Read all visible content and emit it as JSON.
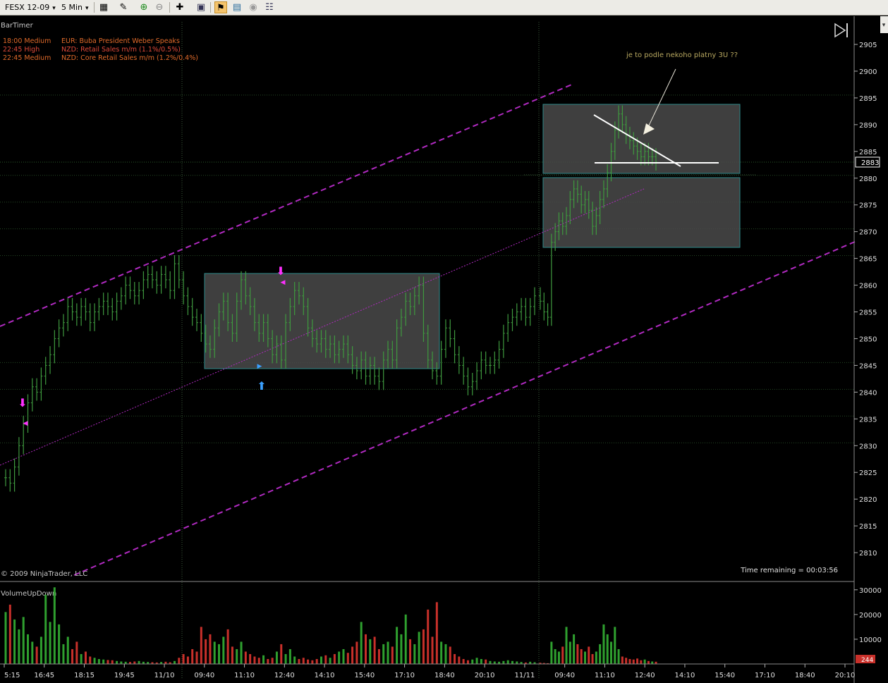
{
  "toolbar": {
    "instrument": "FESX 12-09",
    "interval": "5 Min",
    "icons": [
      "bar-type-icon",
      "draw-pencil-icon",
      "zoom-in-icon",
      "zoom-out-icon",
      "crosshair-icon",
      "data-box-icon",
      "strategy-icon",
      "chart-properties-icon",
      "hide-drawings-icon",
      "instrument-list-icon"
    ]
  },
  "indicators": {
    "bartimer_label": "BarTimer",
    "time_remaining": "Time remaining = 00:03:56",
    "copyright": "© 2009 NinjaTrader, LLC",
    "volume_label": "VolumeUpDown",
    "volume_current": "244"
  },
  "news": [
    {
      "time": "18:00",
      "impact": "Medium",
      "text": "EUR: Buba President Weber Speaks"
    },
    {
      "time": "22:45",
      "impact": "High",
      "text": "NZD: Retail Sales m/m (1.1%/0.5%)"
    },
    {
      "time": "22:45",
      "impact": "Medium",
      "text": "NZD: Core Retail Sales m/m (1.2%/0.4%)"
    }
  ],
  "annotation": "je to podle nekoho platny 3U ??",
  "colors": {
    "background": "#000000",
    "bar": "#3f9a3f",
    "channel": "#b02ac0",
    "box": "#4a4a4a",
    "news_medium": "#e06a2a",
    "news_high": "#e04a3a",
    "volume_up": "#2fa02f",
    "volume_down": "#c8302a",
    "annotation": "#b8a860",
    "price_marker": "#ffffff"
  },
  "chart_data": {
    "type": "bar",
    "title": "",
    "price_axis": {
      "ticks": [
        2810,
        2815,
        2820,
        2825,
        2830,
        2835,
        2840,
        2845,
        2850,
        2855,
        2860,
        2865,
        2870,
        2875,
        2880,
        2885,
        2890,
        2895,
        2900,
        2905
      ],
      "ylim": [
        2807,
        2912
      ],
      "last_price": "2883"
    },
    "time_axis": {
      "labels": [
        "5:15",
        "16:45",
        "18:15",
        "19:45",
        "11/10",
        "09:40",
        "11:10",
        "12:40",
        "14:10",
        "15:40",
        "17:10",
        "18:40",
        "20:10",
        "11/11",
        "09:40",
        "11:10",
        "12:40",
        "14:10",
        "15:40",
        "17:10",
        "18:40",
        "20:10"
      ],
      "session_breaks": [
        "11/10",
        "11/11"
      ]
    },
    "price_series_closes": [
      2824,
      2823,
      2826,
      2830,
      2834,
      2838,
      2841,
      2840,
      2843,
      2845,
      2847,
      2850,
      2852,
      2853,
      2856,
      2855,
      2854,
      2856,
      2855,
      2853,
      2855,
      2856,
      2857,
      2856,
      2855,
      2857,
      2858,
      2860,
      2859,
      2858,
      2859,
      2861,
      2862,
      2861,
      2860,
      2862,
      2861,
      2859,
      2864,
      2861,
      2858,
      2856,
      2854,
      2853,
      2851,
      2849,
      2848,
      2852,
      2855,
      2857,
      2853,
      2851,
      2857,
      2861,
      2858,
      2856,
      2853,
      2851,
      2853,
      2850,
      2847,
      2849,
      2846,
      2853,
      2856,
      2859,
      2858,
      2856,
      2852,
      2850,
      2849,
      2850,
      2848,
      2849,
      2847,
      2848,
      2849,
      2847,
      2845,
      2844,
      2846,
      2843,
      2845,
      2843,
      2842,
      2846,
      2848,
      2846,
      2852,
      2854,
      2857,
      2856,
      2858,
      2860,
      2851,
      2846,
      2844,
      2843,
      2848,
      2852,
      2850,
      2847,
      2845,
      2843,
      2841,
      2842,
      2844,
      2846,
      2845,
      2845,
      2846,
      2848,
      2851,
      2853,
      2854,
      2855,
      2856,
      2854,
      2856,
      2858,
      2857,
      2855,
      2854,
      2868,
      2870,
      2872,
      2871,
      2873,
      2876,
      2878,
      2877,
      2875,
      2876,
      2874,
      2871,
      2873,
      2876,
      2878,
      2881,
      2885,
      2889,
      2892,
      2890,
      2888,
      2887,
      2886,
      2885,
      2884,
      2885,
      2884,
      2884,
      2883
    ],
    "volume_axis": {
      "ticks": [
        10000,
        20000,
        30000
      ],
      "ylim": [
        0,
        32500
      ]
    },
    "volume_series": [
      21000,
      24000,
      18000,
      14000,
      19000,
      12000,
      9000,
      7000,
      11000,
      28000,
      17000,
      31000,
      16000,
      8000,
      11000,
      6000,
      9000,
      4000,
      5000,
      3000,
      2500,
      2000,
      1800,
      1600,
      1500,
      1200,
      1000,
      900,
      800,
      1000,
      1200,
      900,
      800,
      700,
      600,
      800,
      900,
      700,
      1200,
      2500,
      4000,
      3000,
      6000,
      5000,
      15000,
      10000,
      12000,
      9000,
      8000,
      11000,
      14000,
      7000,
      6000,
      9000,
      5000,
      4000,
      3000,
      2500,
      3500,
      2000,
      2500,
      5000,
      8000,
      4000,
      6000,
      3000,
      2000,
      2500,
      1800,
      1500,
      2000,
      3000,
      3500,
      2500,
      4000,
      5000,
      6000,
      4500,
      7000,
      9000,
      17000,
      12000,
      10000,
      11000,
      6000,
      8000,
      9000,
      7000,
      15000,
      12000,
      20000,
      10000,
      8000,
      13000,
      14000,
      22000,
      11000,
      25000,
      9000,
      8000,
      7000,
      4000,
      3000,
      2000,
      1500,
      1800,
      2500,
      2000,
      1800,
      1200,
      1000,
      900,
      1200,
      1500,
      1200,
      1000,
      800,
      600,
      900,
      700,
      500,
      400,
      300,
      9000,
      6000,
      5000,
      7000,
      15000,
      9000,
      12000,
      8000,
      6000,
      5000,
      7000,
      4000,
      5000,
      8000,
      16000,
      12000,
      9000,
      15000,
      6000,
      3000,
      2500,
      2000,
      1800,
      2200,
      1500,
      1800,
      1200,
      1000,
      900
    ]
  }
}
